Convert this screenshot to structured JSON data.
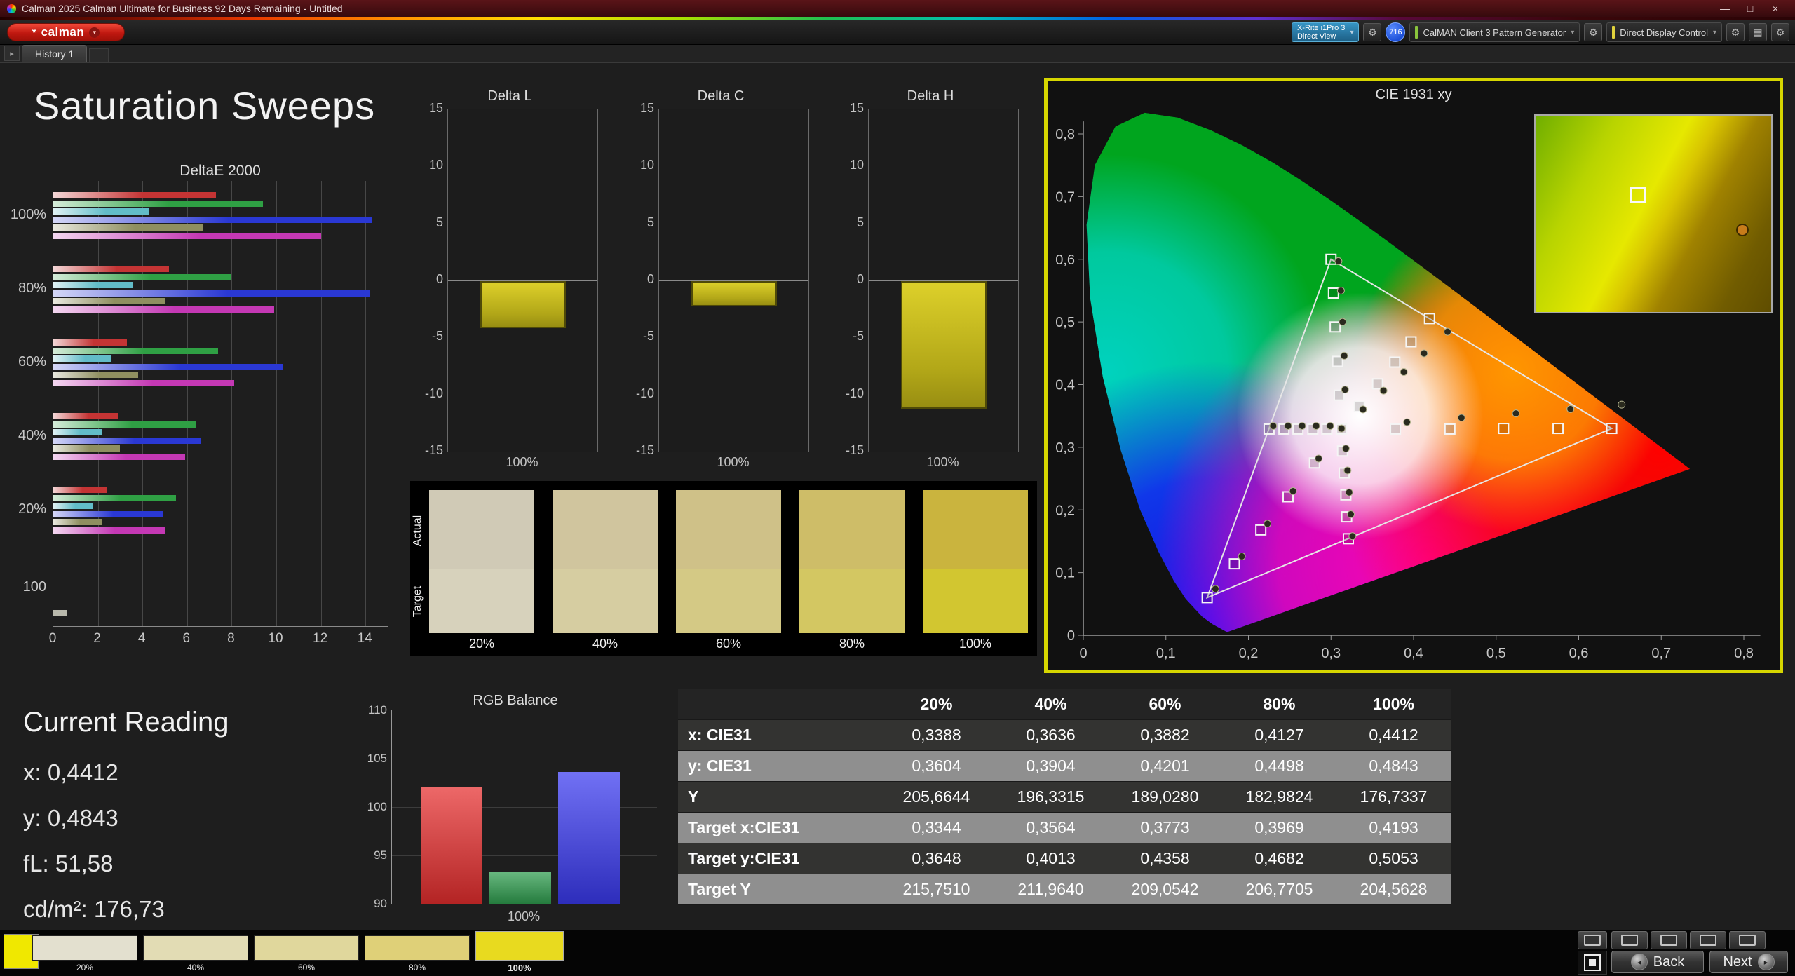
{
  "window": {
    "title": "Calman 2025 Calman Ultimate for Business 92 Days Remaining  - Untitled",
    "minimize": "—",
    "maximize": "□",
    "close": "×"
  },
  "logo": {
    "label": "calman",
    "star": "*",
    "chevron": "▾"
  },
  "toolbar": {
    "meter_line1": "X-Rite i1Pro 3",
    "meter_line2": "Direct View",
    "badge": "716",
    "pattern_generator": "CalMAN Client 3 Pattern Generator",
    "display_control": "Direct Display Control"
  },
  "tabbar": {
    "tab": "History 1"
  },
  "page_title": "Saturation Sweeps",
  "chart_data": [
    {
      "id": "deltae2000",
      "type": "bar",
      "orientation": "horizontal",
      "title": "DeltaE 2000",
      "xlim": [
        0,
        14
      ],
      "xticks": [
        0,
        2,
        4,
        6,
        8,
        10,
        12,
        14
      ],
      "groups": [
        {
          "label": "100%",
          "values": [
            7.3,
            9.4,
            4.3,
            14.3,
            6.7,
            12.0
          ]
        },
        {
          "label": "80%",
          "values": [
            5.2,
            8.0,
            3.6,
            14.2,
            5.0,
            9.9
          ]
        },
        {
          "label": "60%",
          "values": [
            3.3,
            7.4,
            2.6,
            10.3,
            3.8,
            8.1
          ]
        },
        {
          "label": "40%",
          "values": [
            2.9,
            6.4,
            2.2,
            6.6,
            3.0,
            5.9
          ]
        },
        {
          "label": "20%",
          "values": [
            2.4,
            5.5,
            1.8,
            4.9,
            2.2,
            5.0
          ]
        },
        {
          "label": "100",
          "values": [
            0.6
          ]
        }
      ],
      "series_colors": [
        "#c43434",
        "#2fa044",
        "#62bcc8",
        "#2a38d4",
        "#8f8f60",
        "#c438b4"
      ],
      "single_color": "#b8b8ac"
    },
    {
      "id": "deltaL",
      "type": "bar",
      "title": "Delta L",
      "categories": [
        "100%"
      ],
      "values": [
        -4.1
      ],
      "ylim": [
        -15,
        15
      ],
      "yticks": [
        15,
        10,
        5,
        0,
        -5,
        -10,
        -15
      ],
      "bar_color": "#d8cc22"
    },
    {
      "id": "deltaC",
      "type": "bar",
      "title": "Delta C",
      "categories": [
        "100%"
      ],
      "values": [
        -2.2
      ],
      "ylim": [
        -15,
        15
      ],
      "yticks": [
        15,
        10,
        5,
        0,
        -5,
        -10,
        -15
      ],
      "bar_color": "#d8cc22"
    },
    {
      "id": "deltaH",
      "type": "bar",
      "title": "Delta H",
      "categories": [
        "100%"
      ],
      "values": [
        -11.2
      ],
      "ylim": [
        -15,
        15
      ],
      "yticks": [
        15,
        10,
        5,
        0,
        -5,
        -10,
        -15
      ],
      "bar_color": "#d8cc22"
    },
    {
      "id": "rgbBalance",
      "type": "bar",
      "title": "RGB Balance",
      "categories": [
        "Red",
        "Green",
        "Blue"
      ],
      "values": [
        102.1,
        93.3,
        103.6
      ],
      "colors": [
        "#e62e2e",
        "#2f9e4f",
        "#3a3af0"
      ],
      "ylim": [
        90,
        110
      ],
      "yticks": [
        110,
        105,
        100,
        95,
        90
      ],
      "xlabel": "100%"
    },
    {
      "id": "cie1931",
      "type": "scatter",
      "title": "CIE 1931 xy",
      "xlim": [
        0,
        0.8
      ],
      "ylim": [
        0,
        0.8
      ],
      "xtick_labels": [
        "0",
        "0,1",
        "0,2",
        "0,3",
        "0,4",
        "0,5",
        "0,6",
        "0,7",
        "0,8"
      ],
      "ytick_labels": [
        "0",
        "0,1",
        "0,2",
        "0,3",
        "0,4",
        "0,5",
        "0,6",
        "0,7",
        "0,8"
      ],
      "gamut_triangle": [
        [
          0.64,
          0.33
        ],
        [
          0.3,
          0.6
        ],
        [
          0.15,
          0.06
        ]
      ],
      "white_point": [
        0.3127,
        0.329
      ],
      "target_squares": [
        [
          0.3344,
          0.3648
        ],
        [
          0.3564,
          0.4013
        ],
        [
          0.3773,
          0.4358
        ],
        [
          0.3969,
          0.4682
        ],
        [
          0.4193,
          0.5053
        ],
        [
          0.378,
          0.329
        ],
        [
          0.444,
          0.329
        ],
        [
          0.509,
          0.33
        ],
        [
          0.575,
          0.33
        ],
        [
          0.64,
          0.33
        ],
        [
          0.31,
          0.383
        ],
        [
          0.308,
          0.437
        ],
        [
          0.305,
          0.492
        ],
        [
          0.303,
          0.546
        ],
        [
          0.3,
          0.6
        ],
        [
          0.28,
          0.275
        ],
        [
          0.248,
          0.221
        ],
        [
          0.215,
          0.168
        ],
        [
          0.183,
          0.114
        ],
        [
          0.15,
          0.06
        ],
        [
          0.295,
          0.329
        ],
        [
          0.278,
          0.329
        ],
        [
          0.26,
          0.329
        ],
        [
          0.243,
          0.329
        ],
        [
          0.225,
          0.329
        ],
        [
          0.314,
          0.294
        ],
        [
          0.316,
          0.259
        ],
        [
          0.318,
          0.224
        ],
        [
          0.319,
          0.189
        ],
        [
          0.321,
          0.154
        ],
        [
          0.3127,
          0.329
        ]
      ],
      "measured_dots": [
        [
          0.3388,
          0.3604
        ],
        [
          0.3636,
          0.3904
        ],
        [
          0.3882,
          0.4201
        ],
        [
          0.4127,
          0.4498
        ],
        [
          0.4412,
          0.4843
        ],
        [
          0.392,
          0.34
        ],
        [
          0.458,
          0.347
        ],
        [
          0.524,
          0.354
        ],
        [
          0.59,
          0.361
        ],
        [
          0.652,
          0.368
        ],
        [
          0.317,
          0.392
        ],
        [
          0.316,
          0.446
        ],
        [
          0.314,
          0.5
        ],
        [
          0.312,
          0.55
        ],
        [
          0.309,
          0.597
        ],
        [
          0.285,
          0.282
        ],
        [
          0.254,
          0.23
        ],
        [
          0.223,
          0.178
        ],
        [
          0.192,
          0.126
        ],
        [
          0.16,
          0.074
        ],
        [
          0.299,
          0.334
        ],
        [
          0.282,
          0.334
        ],
        [
          0.265,
          0.334
        ],
        [
          0.248,
          0.334
        ],
        [
          0.23,
          0.334
        ],
        [
          0.318,
          0.298
        ],
        [
          0.32,
          0.263
        ],
        [
          0.322,
          0.228
        ],
        [
          0.324,
          0.193
        ],
        [
          0.326,
          0.158
        ],
        [
          0.3127,
          0.33
        ]
      ]
    }
  ],
  "swatch_panel": {
    "row_labels": [
      "Actual",
      "Target"
    ],
    "column_labels": [
      "20%",
      "40%",
      "60%",
      "80%",
      "100%"
    ],
    "actual_colors": [
      "#d0cab6",
      "#d0c59e",
      "#cfc188",
      "#cebd68",
      "#cab43e"
    ],
    "target_colors": [
      "#d7d2bc",
      "#d6cda1",
      "#d4c985",
      "#d3c762",
      "#d2c630"
    ]
  },
  "current_reading": {
    "title": "Current Reading",
    "lines": [
      "x: 0,4412",
      "y: 0,4843",
      "fL: 51,58",
      "cd/m²: 176,73"
    ]
  },
  "table": {
    "header": [
      "",
      "20%",
      "40%",
      "60%",
      "80%",
      "100%"
    ],
    "rows": [
      {
        "label": "x: CIE31",
        "values": [
          "0,3388",
          "0,3636",
          "0,3882",
          "0,4127",
          "0,4412"
        ]
      },
      {
        "label": "y: CIE31",
        "values": [
          "0,3604",
          "0,3904",
          "0,4201",
          "0,4498",
          "0,4843"
        ]
      },
      {
        "label": "Y",
        "values": [
          "205,6644",
          "196,3315",
          "189,0280",
          "182,9824",
          "176,7337"
        ]
      },
      {
        "label": "Target x:CIE31",
        "values": [
          "0,3344",
          "0,3564",
          "0,3773",
          "0,3969",
          "0,4193"
        ]
      },
      {
        "label": "Target y:CIE31",
        "values": [
          "0,3648",
          "0,4013",
          "0,4358",
          "0,4682",
          "0,5053"
        ]
      },
      {
        "label": "Target Y",
        "values": [
          "215,7510",
          "211,9640",
          "209,0542",
          "206,7705",
          "204,5628"
        ]
      }
    ]
  },
  "bottom_bar": {
    "active_swatch_color": "#f0e800",
    "swatches": [
      {
        "label": "20%",
        "color": "#e3e0cf"
      },
      {
        "label": "40%",
        "color": "#e2dcb4"
      },
      {
        "label": "60%",
        "color": "#e0d79c"
      },
      {
        "label": "80%",
        "color": "#dfd078"
      },
      {
        "label": "100%",
        "color": "#e8da1f",
        "selected": true
      }
    ],
    "back_label": "Back",
    "next_label": "Next"
  }
}
